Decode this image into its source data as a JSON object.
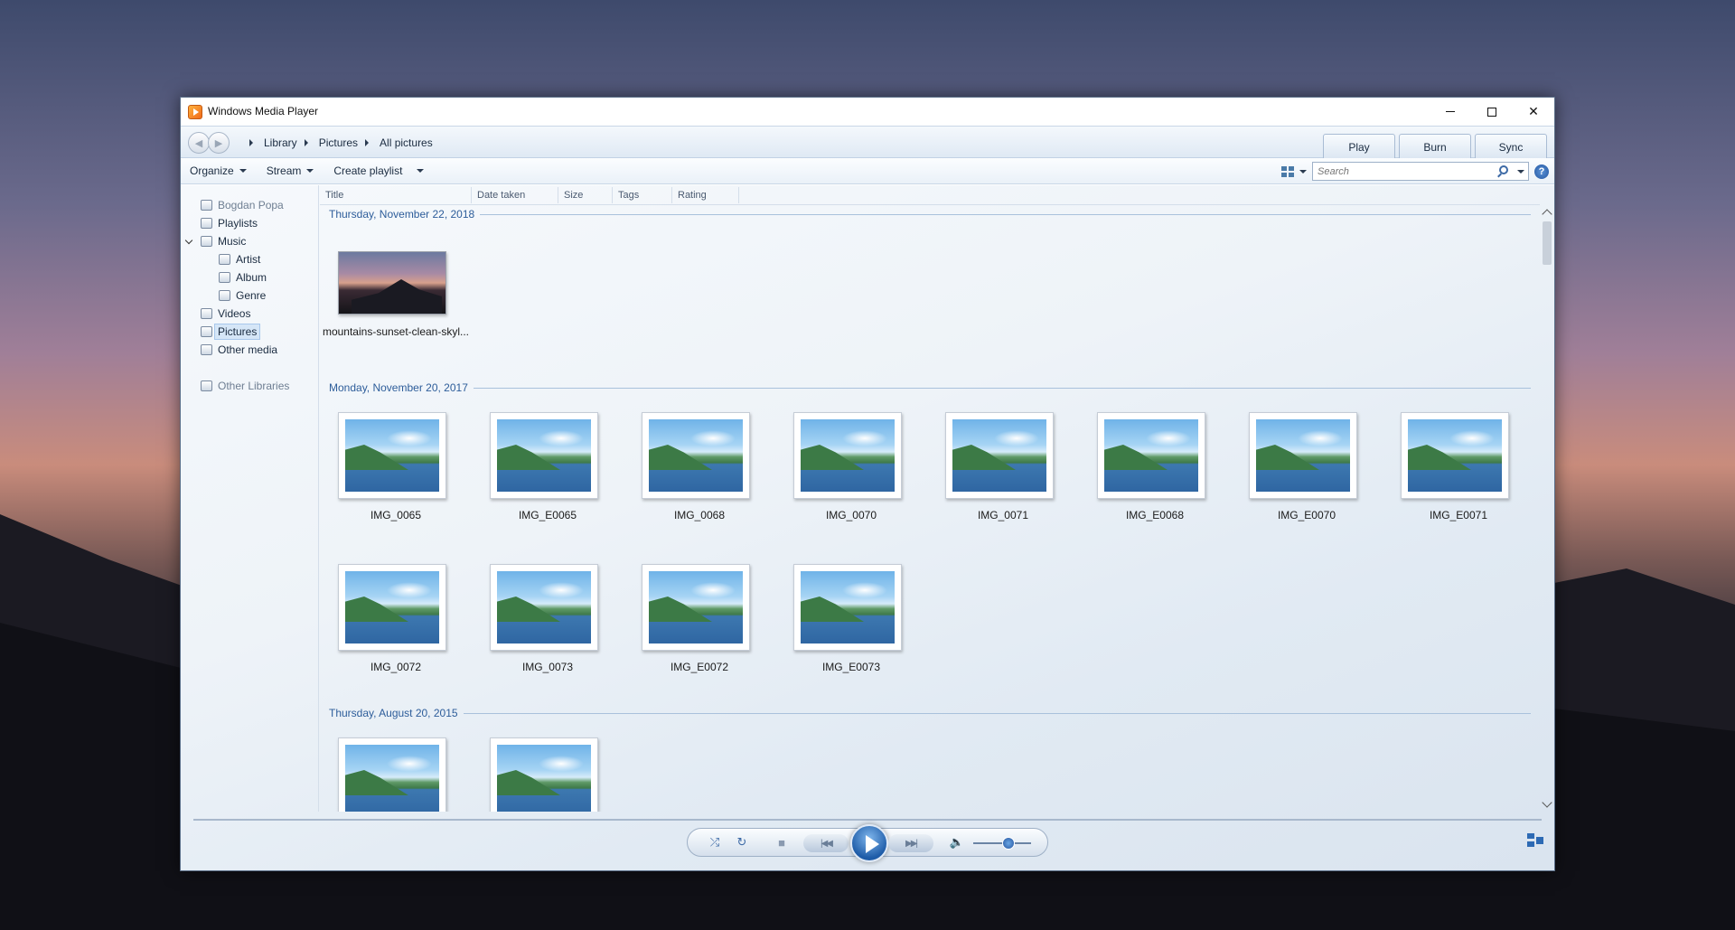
{
  "window": {
    "title": "Windows Media Player"
  },
  "breadcrumb": [
    "Library",
    "Pictures",
    "All pictures"
  ],
  "tabs": [
    "Play",
    "Burn",
    "Sync"
  ],
  "toolbar": {
    "organize": "Organize",
    "stream": "Stream",
    "create_playlist": "Create playlist"
  },
  "search": {
    "placeholder": "Search"
  },
  "sidebar": {
    "user": "Bogdan Popa",
    "items": [
      "Playlists",
      "Music",
      "Artist",
      "Album",
      "Genre",
      "Videos",
      "Pictures",
      "Other media"
    ],
    "other_libraries": "Other Libraries",
    "selected": "Pictures"
  },
  "columns": [
    "Title",
    "Date taken",
    "Size",
    "Tags",
    "Rating"
  ],
  "groups": [
    {
      "date": "Thursday, November 22, 2018",
      "items": [
        "mountains-sunset-clean-skyl..."
      ]
    },
    {
      "date": "Monday, November 20, 2017",
      "items": [
        "IMG_0065",
        "IMG_E0065",
        "IMG_0068",
        "IMG_0070",
        "IMG_0071",
        "IMG_E0068",
        "IMG_E0070",
        "IMG_E0071",
        "IMG_0072",
        "IMG_0073",
        "IMG_E0072",
        "IMG_E0073"
      ]
    },
    {
      "date": "Thursday, August 20, 2015",
      "items": [
        "",
        ""
      ]
    }
  ],
  "player": {
    "volume_level": 0.5
  },
  "colors": {
    "accent": "#2d5d9a",
    "play_button": "#1e5ca8"
  },
  "icons": [
    "back-icon",
    "forward-icon",
    "search-icon",
    "help-icon",
    "shuffle-icon",
    "repeat-icon",
    "stop-icon",
    "previous-icon",
    "play-icon",
    "next-icon",
    "volume-icon",
    "switch-to-now-playing-icon"
  ]
}
